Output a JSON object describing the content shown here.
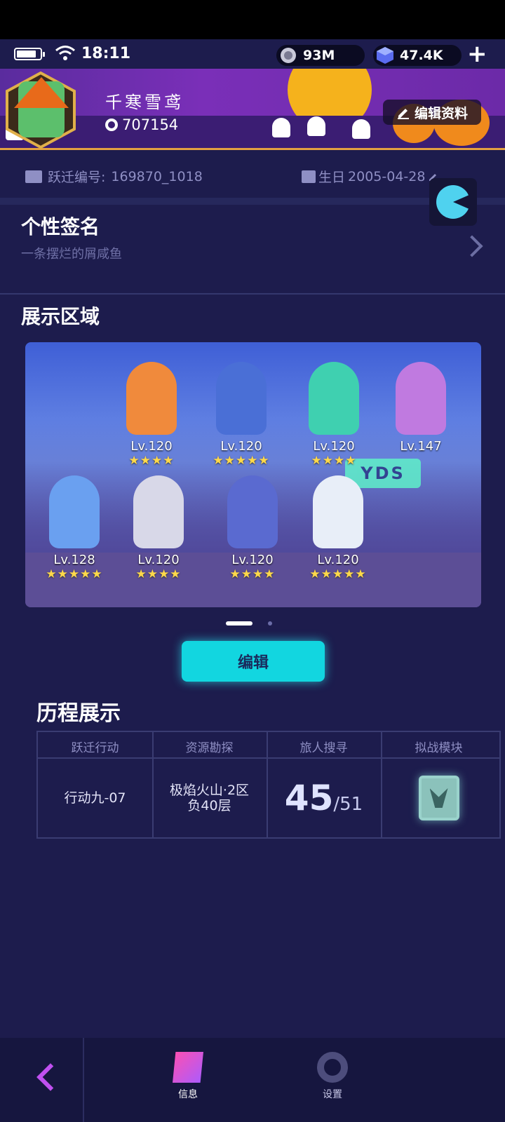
{
  "status_bar": {
    "time": "18:11",
    "battery_level": 0.85,
    "coins": "93M",
    "gems": "47.4K",
    "add_label": "+"
  },
  "profile": {
    "nickname": "千寒雪鸢",
    "uid": "707154",
    "edit_profile_label": "编辑资料",
    "jump_id_label": "跃迁编号:",
    "jump_id": "169870_1018",
    "birthday_label": "生日",
    "birthday": "2005-04-28"
  },
  "signature": {
    "title": "个性签名",
    "text": "一条摆烂的屑咸鱼"
  },
  "showcase": {
    "title": "展示区域",
    "sign_text": "YDS",
    "heroes": [
      {
        "level": "Lv.120",
        "stars": "★★★★",
        "color": "#f08a3c"
      },
      {
        "level": "Lv.120",
        "stars": "★★★★★",
        "color": "#4a6fd6"
      },
      {
        "level": "Lv.120",
        "stars": "★★★★",
        "color": "#3fd0b0"
      },
      {
        "level": "Lv.147",
        "stars": "",
        "color": "#c07ae0"
      },
      {
        "level": "Lv.128",
        "stars": "★★★★★",
        "color": "#6aa0f0"
      },
      {
        "level": "Lv.120",
        "stars": "★★★★",
        "color": "#d8d8e8"
      },
      {
        "level": "Lv.120",
        "stars": "★★★★",
        "color": "#5a6ad0"
      },
      {
        "level": "Lv.120",
        "stars": "★★★★★",
        "color": "#e8eef8"
      }
    ],
    "page_count": 2,
    "current_page": 1
  },
  "edit_button_label": "编辑",
  "history": {
    "title": "历程展示",
    "columns": [
      {
        "header": "跃迁行动",
        "value": "行动九-07"
      },
      {
        "header": "资源勘探",
        "value": "极焰火山·2区 负40层"
      },
      {
        "header": "旅人搜寻",
        "value_main": "45",
        "value_sub": "/51"
      },
      {
        "header": "拟战模块",
        "value": ""
      }
    ]
  },
  "bottom_nav": {
    "info_label": "信息",
    "settings_label": "设置"
  }
}
